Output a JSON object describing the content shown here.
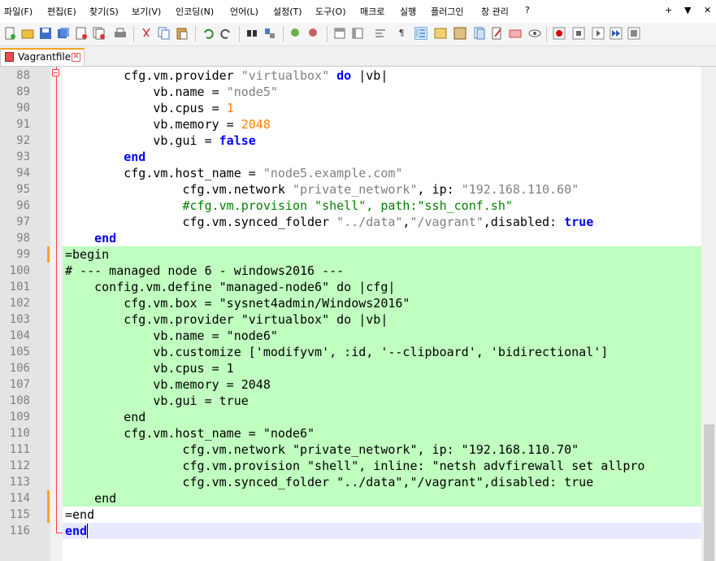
{
  "menubar": {
    "items": [
      "파일(F)",
      "편집(E)",
      "찾기(S)",
      "보기(V)",
      "인코딩(N)",
      "언어(L)",
      "설정(T)",
      "도구(O)",
      "매크로",
      "실행",
      "플러그인",
      "창 관리",
      "?"
    ],
    "right": [
      "+",
      "▼",
      "✕"
    ]
  },
  "toolbar": {
    "icons": [
      "new-file-icon",
      "open-file-icon",
      "save-icon",
      "save-all-icon",
      "close-icon",
      "close-all-icon",
      "print-icon",
      "cut-icon",
      "copy-icon",
      "paste-icon",
      "undo-icon",
      "redo-icon",
      "find-icon",
      "replace-icon",
      "zoom-in-icon",
      "zoom-out-icon",
      "sync-vertical-icon",
      "sync-horizontal-icon",
      "word-wrap-icon",
      "show-all-chars-icon",
      "indent-guide-icon",
      "language-icon",
      "doc-map-icon",
      "function-list-icon",
      "folder-workspace-icon",
      "monitoring-icon",
      "spellcheck-icon",
      "record-macro-icon",
      "stop-macro-icon",
      "play-macro-icon",
      "run-macro-multiple-icon",
      "save-macro-icon"
    ]
  },
  "tab": {
    "label": "Vagrantfile"
  },
  "editor": {
    "lines": [
      {
        "n": "88",
        "tokens": [
          [
            "        ",
            ""
          ],
          [
            "cfg.vm.provider ",
            ""
          ],
          [
            "\"virtualbox\"",
            "str"
          ],
          [
            " ",
            ""
          ],
          [
            "do",
            "kw"
          ],
          [
            " |vb|",
            ""
          ]
        ]
      },
      {
        "n": "89",
        "tokens": [
          [
            "            vb.name = ",
            ""
          ],
          [
            "\"node5\"",
            "str"
          ]
        ]
      },
      {
        "n": "90",
        "tokens": [
          [
            "            vb.cpus = ",
            ""
          ],
          [
            "1",
            "num"
          ]
        ]
      },
      {
        "n": "91",
        "tokens": [
          [
            "            vb.memory = ",
            ""
          ],
          [
            "2048",
            "num"
          ]
        ]
      },
      {
        "n": "92",
        "tokens": [
          [
            "            vb.gui = ",
            ""
          ],
          [
            "false",
            "kw"
          ]
        ]
      },
      {
        "n": "93",
        "tokens": [
          [
            "        ",
            ""
          ],
          [
            "end",
            "kw"
          ]
        ]
      },
      {
        "n": "94",
        "tokens": [
          [
            "        cfg.vm.host_name = ",
            ""
          ],
          [
            "\"node5.example.com\"",
            "str"
          ]
        ]
      },
      {
        "n": "95",
        "tokens": [
          [
            "                cfg.vm.network ",
            ""
          ],
          [
            "\"private_network\"",
            "str"
          ],
          [
            ", ip: ",
            ""
          ],
          [
            "\"192.168.110.60\"",
            "str"
          ]
        ]
      },
      {
        "n": "96",
        "tokens": [
          [
            "                ",
            ""
          ],
          [
            "#cfg.vm.provision \"shell\", path:\"ssh_conf.sh\"",
            "cmt"
          ]
        ]
      },
      {
        "n": "97",
        "tokens": [
          [
            "                cfg.vm.synced_folder ",
            ""
          ],
          [
            "\"../data\"",
            "str"
          ],
          [
            ",",
            ""
          ],
          [
            "\"/vagrant\"",
            "str"
          ],
          [
            ",disabled: ",
            ""
          ],
          [
            "true",
            "kw"
          ]
        ]
      },
      {
        "n": "98",
        "tokens": [
          [
            "    ",
            ""
          ],
          [
            "end",
            "kw"
          ]
        ]
      },
      {
        "n": "99",
        "tokens": [
          [
            "=begin",
            ""
          ]
        ]
      },
      {
        "n": "100",
        "tokens": [
          [
            "# --- managed node 6 - windows2016 ---",
            ""
          ]
        ]
      },
      {
        "n": "101",
        "tokens": [
          [
            "    config.vm.define \"managed-node6\" do |cfg|",
            ""
          ]
        ]
      },
      {
        "n": "102",
        "tokens": [
          [
            "        cfg.vm.box = \"sysnet4admin/Windows2016\"",
            ""
          ]
        ]
      },
      {
        "n": "103",
        "tokens": [
          [
            "        cfg.vm.provider \"virtualbox\" do |vb|",
            ""
          ]
        ]
      },
      {
        "n": "104",
        "tokens": [
          [
            "            vb.name = \"node6\"",
            ""
          ]
        ]
      },
      {
        "n": "105",
        "tokens": [
          [
            "            vb.customize ['modifyvm', :id, '--clipboard', 'bidirectional']",
            ""
          ]
        ]
      },
      {
        "n": "106",
        "tokens": [
          [
            "            vb.cpus = 1",
            ""
          ]
        ]
      },
      {
        "n": "107",
        "tokens": [
          [
            "            vb.memory = 2048",
            ""
          ]
        ]
      },
      {
        "n": "108",
        "tokens": [
          [
            "            vb.gui = true",
            ""
          ]
        ]
      },
      {
        "n": "109",
        "tokens": [
          [
            "        end",
            ""
          ]
        ]
      },
      {
        "n": "110",
        "tokens": [
          [
            "        cfg.vm.host_name = \"node6\"",
            ""
          ]
        ]
      },
      {
        "n": "111",
        "tokens": [
          [
            "                cfg.vm.network \"private_network\", ip: \"192.168.110.70\"",
            ""
          ]
        ]
      },
      {
        "n": "112",
        "tokens": [
          [
            "                cfg.vm.provision \"shell\", inline: \"netsh advfirewall set allpro",
            ""
          ]
        ]
      },
      {
        "n": "113",
        "tokens": [
          [
            "                cfg.vm.synced_folder \"../data\",\"/vagrant\",disabled: true",
            ""
          ]
        ]
      },
      {
        "n": "114",
        "tokens": [
          [
            "    end",
            ""
          ]
        ]
      },
      {
        "n": "115",
        "tokens": [
          [
            "=end",
            ""
          ]
        ]
      },
      {
        "n": "116",
        "tokens": [
          [
            "end",
            "kw"
          ]
        ]
      }
    ]
  }
}
